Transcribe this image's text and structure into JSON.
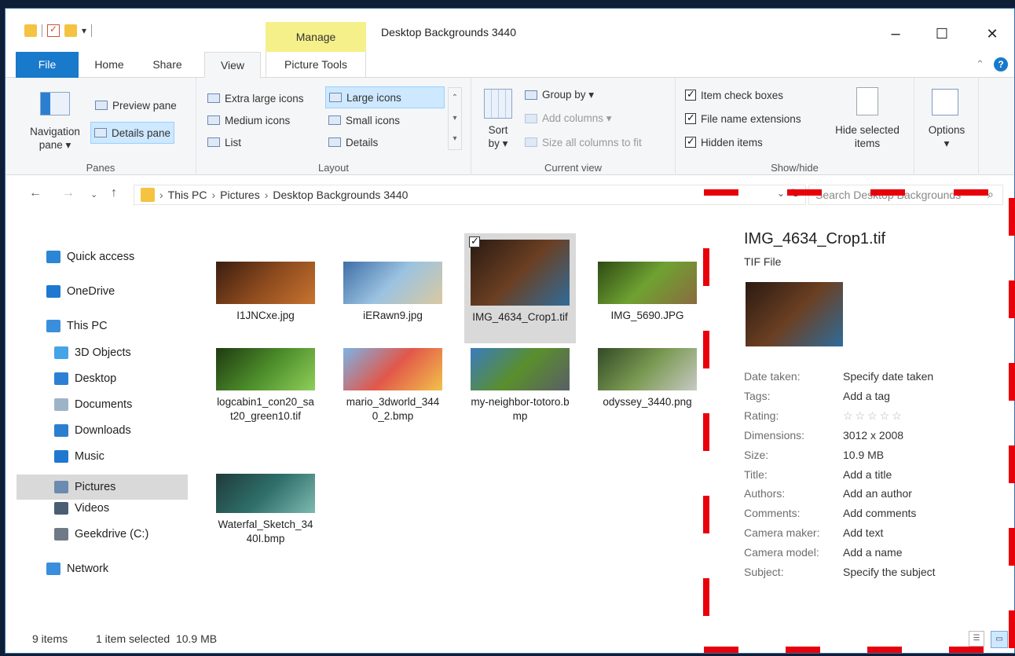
{
  "window": {
    "title": "Desktop Backgrounds 3440",
    "context_tab": "Manage",
    "controls": [
      "–",
      "☐",
      "✕"
    ]
  },
  "tabs": {
    "file": "File",
    "home": "Home",
    "share": "Share",
    "view": "View",
    "picture_tools": "Picture Tools"
  },
  "ribbon": {
    "panes": {
      "label": "Panes",
      "navigation_pane": "Navigation\npane ▾",
      "preview_pane": "Preview pane",
      "details_pane": "Details pane"
    },
    "layout": {
      "label": "Layout",
      "items": [
        "Extra large icons",
        "Large icons",
        "Medium icons",
        "Small icons",
        "List",
        "Details"
      ]
    },
    "current_view": {
      "label": "Current view",
      "sort_by": "Sort\nby ▾",
      "group_by": "Group by ▾",
      "add_columns": "Add columns ▾",
      "size_columns": "Size all columns to fit"
    },
    "show_hide": {
      "label": "Show/hide",
      "item_check_boxes": "Item check boxes",
      "file_name_extensions": "File name extensions",
      "hidden_items": "Hidden items",
      "hide_selected": "Hide selected\nitems"
    },
    "options": "Options\n▾"
  },
  "address": {
    "crumbs": [
      "This PC",
      "Pictures",
      "Desktop Backgrounds 3440"
    ],
    "search_placeholder": "Search Desktop Backgrounds"
  },
  "nav": {
    "items": [
      {
        "label": "Quick access",
        "icon": "star-icon",
        "color": "#2b87d6"
      },
      {
        "label": "OneDrive",
        "icon": "cloud-icon",
        "color": "#1e78d0"
      },
      {
        "label": "This PC",
        "icon": "monitor-icon",
        "color": "#3a8fdc"
      },
      {
        "label": "3D Objects",
        "icon": "cube-icon",
        "color": "#45a4e6"
      },
      {
        "label": "Desktop",
        "icon": "desktop-icon",
        "color": "#2d7fd3"
      },
      {
        "label": "Documents",
        "icon": "document-icon",
        "color": "#9fb3c8"
      },
      {
        "label": "Downloads",
        "icon": "download-icon",
        "color": "#2b7fd0"
      },
      {
        "label": "Music",
        "icon": "music-icon",
        "color": "#1e78d0"
      },
      {
        "label": "Pictures",
        "icon": "pictures-icon",
        "color": "#6b8bb0"
      },
      {
        "label": "Videos",
        "icon": "film-icon",
        "color": "#4a5d73"
      },
      {
        "label": "Geekdrive (C:)",
        "icon": "drive-icon",
        "color": "#6f7a86"
      },
      {
        "label": "Network",
        "icon": "network-icon",
        "color": "#3a8fdc"
      }
    ]
  },
  "files": [
    {
      "name": "I1JNCxe.jpg",
      "colors": [
        "#3b1d10",
        "#8c4a1e",
        "#c8742f"
      ]
    },
    {
      "name": "iERawn9.jpg",
      "colors": [
        "#3f6fa8",
        "#9cc3e0",
        "#d9c9a0"
      ]
    },
    {
      "name": "IMG_4634_Crop1.tif",
      "colors": [
        "#2a1a12",
        "#6b3f22",
        "#2f6c9a"
      ],
      "selected": true
    },
    {
      "name": "IMG_5690.JPG",
      "colors": [
        "#2e4a14",
        "#6fa232",
        "#8a6a3f"
      ]
    },
    {
      "name": "logcabin1_con20_sat20_green10.tif",
      "colors": [
        "#1f3a12",
        "#4c8c2a",
        "#8fcf5a"
      ]
    },
    {
      "name": "mario_3dworld_3440_2.bmp",
      "colors": [
        "#7cb3e6",
        "#e2574a",
        "#f2c24a"
      ]
    },
    {
      "name": "my-neighbor-totoro.bmp",
      "colors": [
        "#3a7bbf",
        "#5a8f2c",
        "#5a5e66"
      ]
    },
    {
      "name": "odyssey_3440.png",
      "colors": [
        "#344a26",
        "#7a9a52",
        "#c7c9c4"
      ]
    },
    {
      "name": "Waterfal_Sketch_3440I.bmp",
      "colors": [
        "#1f3a3a",
        "#2f6f6a",
        "#7dbab0"
      ]
    }
  ],
  "preview": {
    "file_name": "IMG_4634_Crop1.tif",
    "file_type": "TIF File",
    "props": [
      {
        "k": "Date taken:",
        "v": "Specify date taken"
      },
      {
        "k": "Tags:",
        "v": "Add a tag"
      },
      {
        "k": "Rating:",
        "v": "☆☆☆☆☆"
      },
      {
        "k": "Dimensions:",
        "v": "3012 x 2008"
      },
      {
        "k": "Size:",
        "v": "10.9 MB"
      },
      {
        "k": "Title:",
        "v": "Add a title"
      },
      {
        "k": "Authors:",
        "v": "Add an author"
      },
      {
        "k": "Comments:",
        "v": "Add comments"
      },
      {
        "k": "Camera maker:",
        "v": "Add text"
      },
      {
        "k": "Camera model:",
        "v": "Add a name"
      },
      {
        "k": "Subject:",
        "v": "Specify the subject"
      }
    ]
  },
  "status": {
    "count": "9 items",
    "selection": "1 item selected  10.9 MB"
  },
  "colors": {
    "file_tab": "#1979ca",
    "manage": "#f6f08a",
    "selection": "#cde8ff",
    "dash": "#e8000b"
  }
}
